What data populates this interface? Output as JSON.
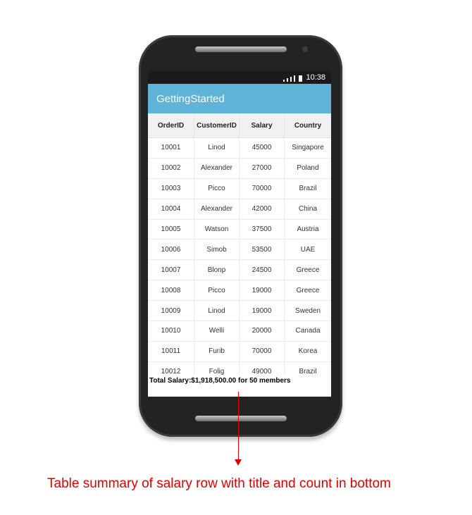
{
  "status_bar": {
    "time": "10:38"
  },
  "app_bar": {
    "title": "GettingStarted"
  },
  "grid": {
    "columns": [
      "OrderID",
      "CustomerID",
      "Salary",
      "Country"
    ],
    "rows": [
      [
        "10001",
        "Linod",
        "45000",
        "Singapore"
      ],
      [
        "10002",
        "Alexander",
        "27000",
        "Poland"
      ],
      [
        "10003",
        "Picco",
        "70000",
        "Brazil"
      ],
      [
        "10004",
        "Alexander",
        "42000",
        "China"
      ],
      [
        "10005",
        "Watson",
        "37500",
        "Austria"
      ],
      [
        "10006",
        "Simob",
        "53500",
        "UAE"
      ],
      [
        "10007",
        "Blonp",
        "24500",
        "Greece"
      ],
      [
        "10008",
        "Picco",
        "19000",
        "Greece"
      ],
      [
        "10009",
        "Linod",
        "19000",
        "Sweden"
      ],
      [
        "10010",
        "Welli",
        "20000",
        "Canada"
      ],
      [
        "10011",
        "Furib",
        "70000",
        "Korea"
      ],
      [
        "10012",
        "Folig",
        "49000",
        "Brazil"
      ]
    ],
    "summary": "Total Salary:$1,918,500.00 for 50 members"
  },
  "annotation": {
    "caption": "Table summary of salary row with title and count in bottom"
  },
  "colors": {
    "app_bar": "#5fb3d9",
    "annotation": "#e00000"
  }
}
